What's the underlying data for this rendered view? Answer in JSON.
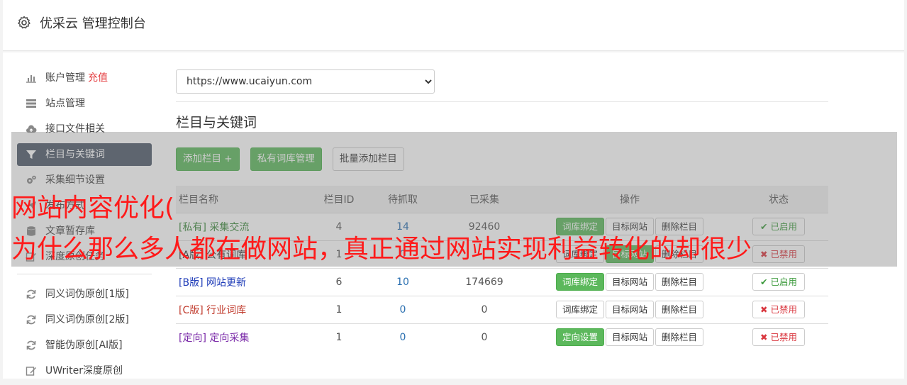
{
  "header": {
    "title": "优采云 管理控制台",
    "icon": "gear-icon"
  },
  "sidebar": {
    "items": [
      {
        "label": "账户管理",
        "extra": "充值",
        "icon": "bar-chart-icon"
      },
      {
        "label": "站点管理",
        "icon": "server-icon"
      },
      {
        "label": "接口文件相关",
        "icon": "cloud-upload-icon"
      },
      {
        "label": "栏目与关键词",
        "icon": "filter-icon",
        "active": true
      },
      {
        "label": "采集细节设置",
        "icon": "gears-icon"
      },
      {
        "label": "发布方式",
        "icon": "send-icon"
      },
      {
        "label": "文章暂存库",
        "icon": "database-icon"
      },
      {
        "label": "深度原创任务",
        "icon": "edit-icon"
      }
    ],
    "tools": [
      {
        "label": "同义词伪原创[1版]",
        "icon": "refresh-icon"
      },
      {
        "label": "同义词伪原创[2版]",
        "icon": "refresh-icon"
      },
      {
        "label": "智能伪原创[AI版]",
        "icon": "refresh-icon"
      },
      {
        "label": "UWriter深度原创",
        "icon": "edit-icon"
      }
    ]
  },
  "site_select": {
    "value": "https://www.ucaiyun.com"
  },
  "section_title": "栏目与关键词",
  "buttons": {
    "add_column": "添加栏目 +",
    "private_lexicon": "私有词库管理",
    "batch_add": "批量添加栏目"
  },
  "table": {
    "headers": [
      "栏目名称",
      "栏目ID",
      "待抓取",
      "已采集",
      "操作",
      "状态"
    ],
    "rows": [
      {
        "tag": "[私有]",
        "name": "采集交流",
        "id": "4",
        "pending": "14",
        "collected": "92460",
        "op1": "词库绑定",
        "op2": "目标网站",
        "op3": "删除栏目",
        "status": "已启用",
        "on": true
      },
      {
        "tag": "[A版]",
        "name": "公有词库",
        "id": "1",
        "pending": "0",
        "collected": "",
        "op1": "词库绑定",
        "op2": "目标网站",
        "op3": "删除栏目",
        "status": "已禁用",
        "on": false
      },
      {
        "tag": "[B版]",
        "name": "网站更新",
        "id": "6",
        "pending": "10",
        "collected": "174669",
        "op1": "词库绑定",
        "op2": "目标网站",
        "op3": "删除栏目",
        "status": "已启用",
        "on": true
      },
      {
        "tag": "[C版]",
        "name": "行业词库",
        "id": "1",
        "pending": "0",
        "collected": "0",
        "op1": "词库绑定",
        "op2": "目标网站",
        "op3": "删除栏目",
        "status": "已禁用",
        "on": false
      },
      {
        "tag": "[定向]",
        "name": "定向采集",
        "id": "1",
        "pending": "0",
        "collected": "0",
        "op1": "定向设置",
        "op2": "目标网站",
        "op3": "删除栏目",
        "status": "已禁用",
        "on": false
      }
    ]
  },
  "watermark": {
    "line1": "网站内容优化(",
    "line2": "为什么那么多人都在做网站，真正通过网站实现利益转化的却很少"
  }
}
